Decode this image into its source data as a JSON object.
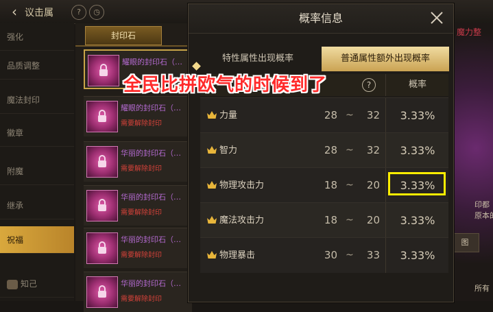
{
  "topbar": {
    "title": "议击属",
    "icon_help": "?",
    "icon_time": "◷"
  },
  "sidebar": {
    "items": [
      {
        "label": "强化"
      },
      {
        "label": "品质调整"
      },
      {
        "label": "魔法封印"
      },
      {
        "label": "徽章"
      },
      {
        "label": "附魔"
      },
      {
        "label": "继承"
      },
      {
        "label": "祝福"
      },
      {
        "label": "知己"
      }
    ]
  },
  "middle": {
    "tab_label": "封印石",
    "items": [
      {
        "name": "耀眼的封印石（…",
        "sub": ""
      },
      {
        "name": "耀眼的封印石（…",
        "sub": "需要解除封印"
      },
      {
        "name": "华丽的封印石（…",
        "sub": "需要解除封印"
      },
      {
        "name": "华丽的封印石（…",
        "sub": "需要解除封印"
      },
      {
        "name": "华丽的封印石（…",
        "sub": "需要解除封印"
      },
      {
        "name": "华丽的封印石（…",
        "sub": "需要解除封印"
      }
    ]
  },
  "right": {
    "label": "魔力整",
    "tag": "图",
    "text1": "印都",
    "text2": "原本的",
    "text3": "所有"
  },
  "dialog": {
    "title": "概率信息",
    "tabs": [
      {
        "label": "特性属性出现概率",
        "active": false
      },
      {
        "label": "普通属性额外出现概率",
        "active": true
      }
    ],
    "header_help": "?",
    "header_prob": "概率",
    "rows": [
      {
        "attr": "力量",
        "min": "28",
        "tilde": "~",
        "max": "32",
        "prob": "3.33%"
      },
      {
        "attr": "智力",
        "min": "28",
        "tilde": "~",
        "max": "32",
        "prob": "3.33%"
      },
      {
        "attr": "物理攻击力",
        "min": "18",
        "tilde": "~",
        "max": "20",
        "prob": "3.33%"
      },
      {
        "attr": "魔法攻击力",
        "min": "18",
        "tilde": "~",
        "max": "20",
        "prob": "3.33%"
      },
      {
        "attr": "物理暴击",
        "min": "30",
        "tilde": "~",
        "max": "33",
        "prob": "3.33%"
      }
    ]
  },
  "overlay_caption": "全民比拼欧气的时候到了",
  "colors": {
    "accent_gold": "#caa353",
    "highlight": "#ffee00",
    "caption": "#ff2a2a"
  }
}
